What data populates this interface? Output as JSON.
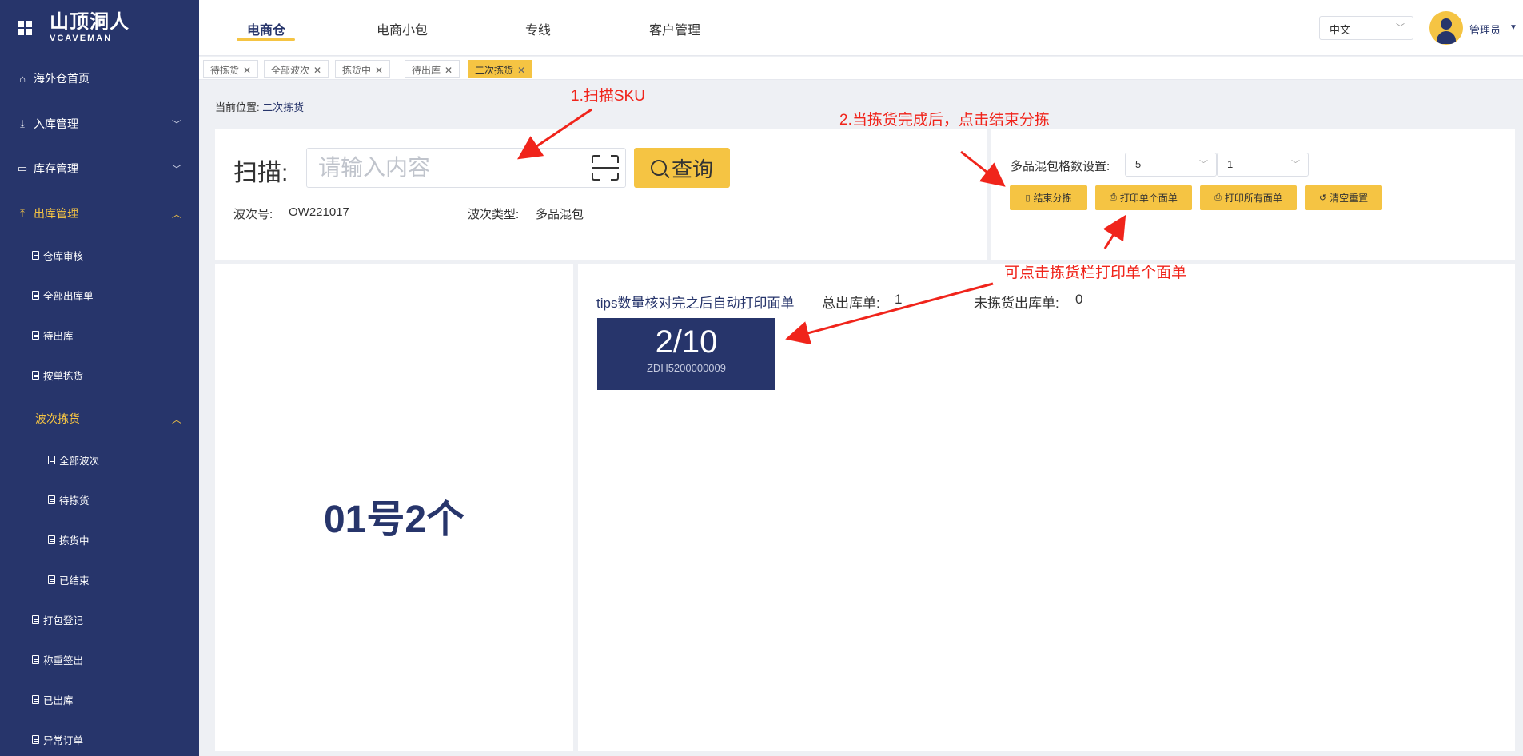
{
  "sidebar": {
    "logo_cn": "山顶洞人",
    "logo_en": "VCAVEMAN",
    "items": [
      {
        "label": "海外仓首页",
        "icon": "home-icon"
      },
      {
        "label": "入库管理",
        "icon": "inbound-icon"
      },
      {
        "label": "库存管理",
        "icon": "inventory-icon"
      },
      {
        "label": "出库管理",
        "icon": "outbound-icon"
      },
      {
        "label": "仓库审核"
      },
      {
        "label": "全部出库单"
      },
      {
        "label": "待出库"
      },
      {
        "label": "按单拣货"
      },
      {
        "label": "波次拣货"
      },
      {
        "label": "全部波次"
      },
      {
        "label": "待拣货"
      },
      {
        "label": "拣货中"
      },
      {
        "label": "已结束"
      },
      {
        "label": "打包登记"
      },
      {
        "label": "称重签出"
      },
      {
        "label": "已出库"
      },
      {
        "label": "异常订单"
      }
    ]
  },
  "header": {
    "tabs": [
      "电商仓",
      "电商小包",
      "专线",
      "客户管理"
    ],
    "language": "中文",
    "user": "管理员"
  },
  "tabbar": {
    "tags": [
      "待拣货",
      "全部波次",
      "拣货中",
      "待出库",
      "二次拣货"
    ]
  },
  "breadcrumb": {
    "prefix": "当前位置:",
    "current": "二次拣货"
  },
  "scan": {
    "label": "扫描:",
    "placeholder": "请输入内容",
    "query_label": "查询",
    "wave_no_label": "波次号:",
    "wave_no": "OW221017",
    "wave_type_label": "波次类型:",
    "wave_type": "多品混包"
  },
  "settings": {
    "label": "多品混包格数设置:",
    "select1": "5",
    "select2": "1",
    "buttons": [
      "结束分拣",
      "打印单个面单",
      "打印所有面单",
      "清空重置"
    ]
  },
  "slot": {
    "text": "01号2个"
  },
  "orders": {
    "tips": "tips数量核对完之后自动打印面单",
    "total_label": "总出库单:",
    "total": "1",
    "unpicked_label": "未拣货出库单:",
    "unpicked": "0",
    "card_fraction": "2/10",
    "card_code": "ZDH5200000009"
  },
  "annotations": {
    "a1": "1.扫描SKU",
    "a2": "2.当拣货完成后，点击结束分拣",
    "a3": "可点击拣货栏打印单个面单"
  },
  "colors": {
    "sidebar": "#27356b",
    "accent": "#f5c443",
    "annotation": "#f0241b"
  }
}
